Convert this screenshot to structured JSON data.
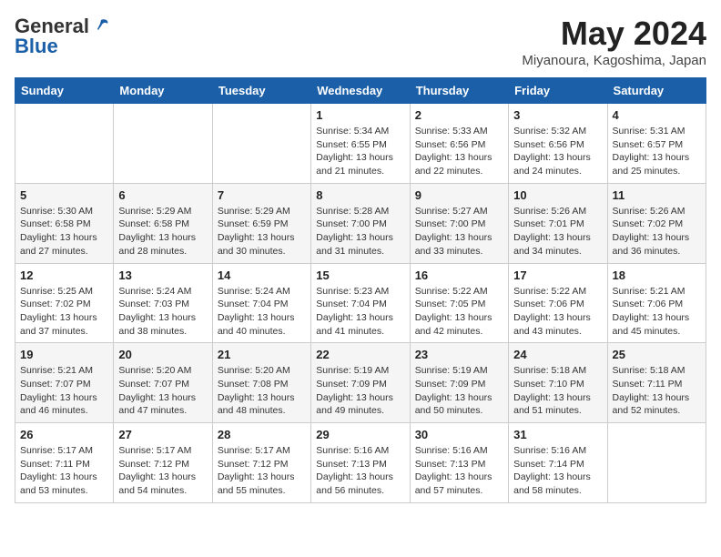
{
  "header": {
    "logo_general": "General",
    "logo_blue": "Blue",
    "title": "May 2024",
    "subtitle": "Miyanoura, Kagoshima, Japan"
  },
  "weekdays": [
    "Sunday",
    "Monday",
    "Tuesday",
    "Wednesday",
    "Thursday",
    "Friday",
    "Saturday"
  ],
  "weeks": [
    [
      {
        "day": "",
        "info": ""
      },
      {
        "day": "",
        "info": ""
      },
      {
        "day": "",
        "info": ""
      },
      {
        "day": "1",
        "info": "Sunrise: 5:34 AM\nSunset: 6:55 PM\nDaylight: 13 hours\nand 21 minutes."
      },
      {
        "day": "2",
        "info": "Sunrise: 5:33 AM\nSunset: 6:56 PM\nDaylight: 13 hours\nand 22 minutes."
      },
      {
        "day": "3",
        "info": "Sunrise: 5:32 AM\nSunset: 6:56 PM\nDaylight: 13 hours\nand 24 minutes."
      },
      {
        "day": "4",
        "info": "Sunrise: 5:31 AM\nSunset: 6:57 PM\nDaylight: 13 hours\nand 25 minutes."
      }
    ],
    [
      {
        "day": "5",
        "info": "Sunrise: 5:30 AM\nSunset: 6:58 PM\nDaylight: 13 hours\nand 27 minutes."
      },
      {
        "day": "6",
        "info": "Sunrise: 5:29 AM\nSunset: 6:58 PM\nDaylight: 13 hours\nand 28 minutes."
      },
      {
        "day": "7",
        "info": "Sunrise: 5:29 AM\nSunset: 6:59 PM\nDaylight: 13 hours\nand 30 minutes."
      },
      {
        "day": "8",
        "info": "Sunrise: 5:28 AM\nSunset: 7:00 PM\nDaylight: 13 hours\nand 31 minutes."
      },
      {
        "day": "9",
        "info": "Sunrise: 5:27 AM\nSunset: 7:00 PM\nDaylight: 13 hours\nand 33 minutes."
      },
      {
        "day": "10",
        "info": "Sunrise: 5:26 AM\nSunset: 7:01 PM\nDaylight: 13 hours\nand 34 minutes."
      },
      {
        "day": "11",
        "info": "Sunrise: 5:26 AM\nSunset: 7:02 PM\nDaylight: 13 hours\nand 36 minutes."
      }
    ],
    [
      {
        "day": "12",
        "info": "Sunrise: 5:25 AM\nSunset: 7:02 PM\nDaylight: 13 hours\nand 37 minutes."
      },
      {
        "day": "13",
        "info": "Sunrise: 5:24 AM\nSunset: 7:03 PM\nDaylight: 13 hours\nand 38 minutes."
      },
      {
        "day": "14",
        "info": "Sunrise: 5:24 AM\nSunset: 7:04 PM\nDaylight: 13 hours\nand 40 minutes."
      },
      {
        "day": "15",
        "info": "Sunrise: 5:23 AM\nSunset: 7:04 PM\nDaylight: 13 hours\nand 41 minutes."
      },
      {
        "day": "16",
        "info": "Sunrise: 5:22 AM\nSunset: 7:05 PM\nDaylight: 13 hours\nand 42 minutes."
      },
      {
        "day": "17",
        "info": "Sunrise: 5:22 AM\nSunset: 7:06 PM\nDaylight: 13 hours\nand 43 minutes."
      },
      {
        "day": "18",
        "info": "Sunrise: 5:21 AM\nSunset: 7:06 PM\nDaylight: 13 hours\nand 45 minutes."
      }
    ],
    [
      {
        "day": "19",
        "info": "Sunrise: 5:21 AM\nSunset: 7:07 PM\nDaylight: 13 hours\nand 46 minutes."
      },
      {
        "day": "20",
        "info": "Sunrise: 5:20 AM\nSunset: 7:07 PM\nDaylight: 13 hours\nand 47 minutes."
      },
      {
        "day": "21",
        "info": "Sunrise: 5:20 AM\nSunset: 7:08 PM\nDaylight: 13 hours\nand 48 minutes."
      },
      {
        "day": "22",
        "info": "Sunrise: 5:19 AM\nSunset: 7:09 PM\nDaylight: 13 hours\nand 49 minutes."
      },
      {
        "day": "23",
        "info": "Sunrise: 5:19 AM\nSunset: 7:09 PM\nDaylight: 13 hours\nand 50 minutes."
      },
      {
        "day": "24",
        "info": "Sunrise: 5:18 AM\nSunset: 7:10 PM\nDaylight: 13 hours\nand 51 minutes."
      },
      {
        "day": "25",
        "info": "Sunrise: 5:18 AM\nSunset: 7:11 PM\nDaylight: 13 hours\nand 52 minutes."
      }
    ],
    [
      {
        "day": "26",
        "info": "Sunrise: 5:17 AM\nSunset: 7:11 PM\nDaylight: 13 hours\nand 53 minutes."
      },
      {
        "day": "27",
        "info": "Sunrise: 5:17 AM\nSunset: 7:12 PM\nDaylight: 13 hours\nand 54 minutes."
      },
      {
        "day": "28",
        "info": "Sunrise: 5:17 AM\nSunset: 7:12 PM\nDaylight: 13 hours\nand 55 minutes."
      },
      {
        "day": "29",
        "info": "Sunrise: 5:16 AM\nSunset: 7:13 PM\nDaylight: 13 hours\nand 56 minutes."
      },
      {
        "day": "30",
        "info": "Sunrise: 5:16 AM\nSunset: 7:13 PM\nDaylight: 13 hours\nand 57 minutes."
      },
      {
        "day": "31",
        "info": "Sunrise: 5:16 AM\nSunset: 7:14 PM\nDaylight: 13 hours\nand 58 minutes."
      },
      {
        "day": "",
        "info": ""
      }
    ]
  ]
}
